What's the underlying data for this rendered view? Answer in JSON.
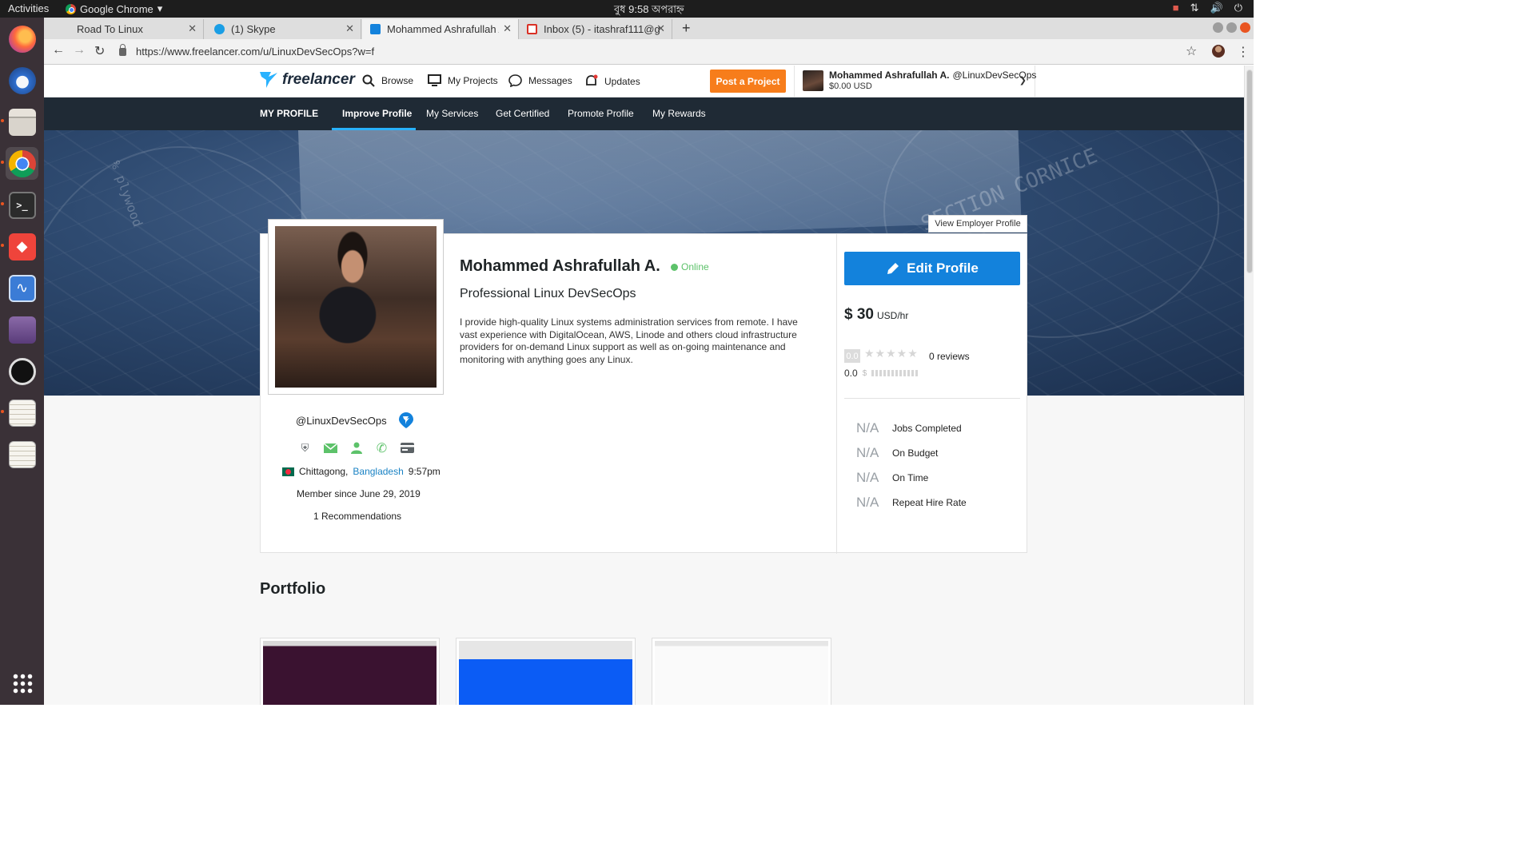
{
  "os": {
    "activities": "Activities",
    "app_name": "Google Chrome",
    "clock": "বুধ 9:58 অপরাহ্ন"
  },
  "tabs": [
    {
      "title": "Road To Linux"
    },
    {
      "title": "(1) Skype"
    },
    {
      "title": "Mohammed Ashrafullah A"
    },
    {
      "title": "Inbox (5) - itashraf111@g"
    }
  ],
  "address": {
    "url": "https://www.freelancer.com/u/LinuxDevSecOps?w=f"
  },
  "header": {
    "logo": "freelancer",
    "nav": [
      "Browse",
      "My Projects",
      "Messages",
      "Updates"
    ],
    "post_button": "Post a Project",
    "account_name": "Mohammed Ashrafullah A.",
    "account_handle": "@LinuxDevSecOps",
    "balance": "$0.00 USD"
  },
  "subnav": {
    "items": [
      "MY PROFILE",
      "Improve Profile",
      "My Services",
      "Get Certified",
      "Promote Profile",
      "My Rewards"
    ]
  },
  "profile": {
    "view_employer": "View Employer Profile",
    "name": "Mohammed Ashrafullah A.",
    "status": "Online",
    "tagline": "Professional Linux DevSecOps",
    "bio": "I provide high-quality Linux systems administration services from remote. I have vast experience with DigitalOcean, AWS, Linode and others cloud infrastructure providers for on-demand Linux support as well as on-going maintenance and monitoring with anything goes any Linux.",
    "handle": "@LinuxDevSecOps",
    "city": "Chittagong,",
    "country": "Bangladesh",
    "local_time": "9:57pm",
    "member_since": "Member since June 29, 2019",
    "recommendations": "1 Recommendations"
  },
  "sidebar": {
    "edit_button": "Edit Profile",
    "rate_value": "$ 30",
    "rate_unit": "USD/hr",
    "rating_score": "0.0",
    "reviews": "0 reviews",
    "earnings_score": "0.0",
    "stats": [
      {
        "value": "N/A",
        "label": "Jobs Completed"
      },
      {
        "value": "N/A",
        "label": "On Budget"
      },
      {
        "value": "N/A",
        "label": "On Time"
      },
      {
        "value": "N/A",
        "label": "Repeat Hire Rate"
      }
    ]
  },
  "portfolio": {
    "title": "Portfolio"
  },
  "colors": {
    "accent_blue": "#1382dc",
    "post_orange": "#f77d1b",
    "online_green": "#5dc26a",
    "subnav_bg": "#1f2a35"
  }
}
